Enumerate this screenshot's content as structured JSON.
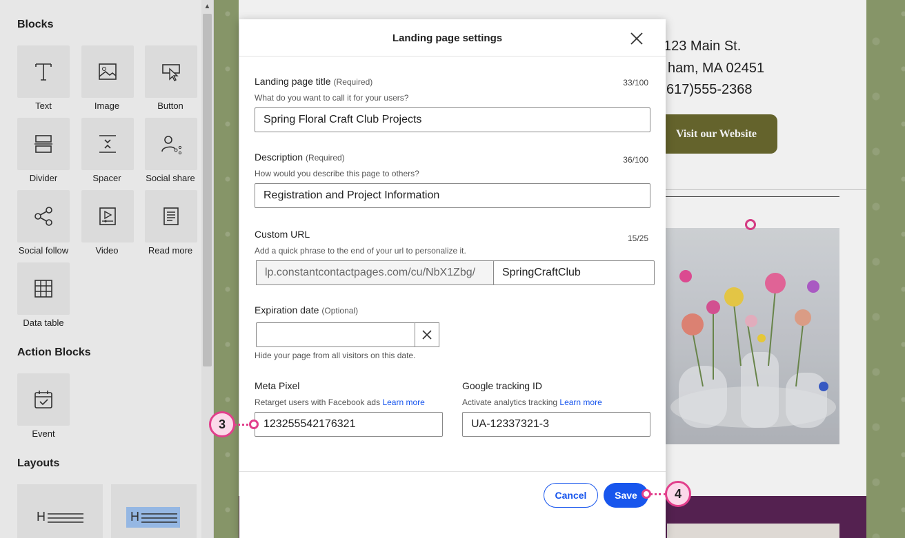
{
  "sidebar": {
    "blocks_heading": "Blocks",
    "blocks": [
      {
        "label": "Text",
        "icon": "text-icon"
      },
      {
        "label": "Image",
        "icon": "image-icon"
      },
      {
        "label": "Button",
        "icon": "button-icon"
      },
      {
        "label": "Divider",
        "icon": "divider-icon"
      },
      {
        "label": "Spacer",
        "icon": "spacer-icon"
      },
      {
        "label": "Social share",
        "icon": "social-share-icon"
      },
      {
        "label": "Social follow",
        "icon": "social-follow-icon"
      },
      {
        "label": "Video",
        "icon": "video-icon"
      },
      {
        "label": "Read more",
        "icon": "read-more-icon"
      },
      {
        "label": "Data table",
        "icon": "data-table-icon"
      }
    ],
    "action_heading": "Action Blocks",
    "action_blocks": [
      {
        "label": "Event",
        "icon": "calendar-icon"
      }
    ],
    "layouts_heading": "Layouts",
    "layouts": [
      {
        "label": "H",
        "icon": "heading-layout-icon"
      },
      {
        "label": "H",
        "icon": "heading-layout-highlighted-icon"
      }
    ]
  },
  "canvas": {
    "address_line1": "123 Main St.",
    "address_line2": "ham, MA 02451",
    "phone": "617)555-2368",
    "visit_button": "Visit our Website"
  },
  "modal": {
    "title": "Landing page settings",
    "close_icon": "close-icon",
    "title_field": {
      "label": "Landing page title",
      "qualifier": "(Required)",
      "help": "What do you want to call it for your users?",
      "count": "33/100",
      "value": "Spring Floral Craft Club Projects"
    },
    "description_field": {
      "label": "Description",
      "qualifier": "(Required)",
      "help": "How would you describe this page to others?",
      "count": "36/100",
      "value": "Registration and Project Information"
    },
    "url_field": {
      "label": "Custom URL",
      "help": "Add a quick phrase to the end of your url to personalize it.",
      "count": "15/25",
      "prefix": "lp.constantcontactpages.com/cu/NbX1Zbg/",
      "value": "SpringCraftClub"
    },
    "expiration_field": {
      "label": "Expiration date",
      "qualifier": "(Optional)",
      "value": "",
      "help": "Hide your page from all visitors on this date."
    },
    "meta_pixel": {
      "label": "Meta Pixel",
      "help": "Retarget users with Facebook ads",
      "link": "Learn more",
      "value": "123255542176321"
    },
    "google_tracking": {
      "label": "Google tracking ID",
      "help": "Activate analytics tracking",
      "link": "Learn more",
      "value": "UA-12337321-3"
    },
    "cancel_label": "Cancel",
    "save_label": "Save"
  },
  "callouts": {
    "step3": "3",
    "step4": "4"
  },
  "colors": {
    "primary": "#1856ed",
    "callout": "#e23f8c",
    "canvas_button": "#6b6a2f",
    "canvas_band": "#5a2456"
  }
}
